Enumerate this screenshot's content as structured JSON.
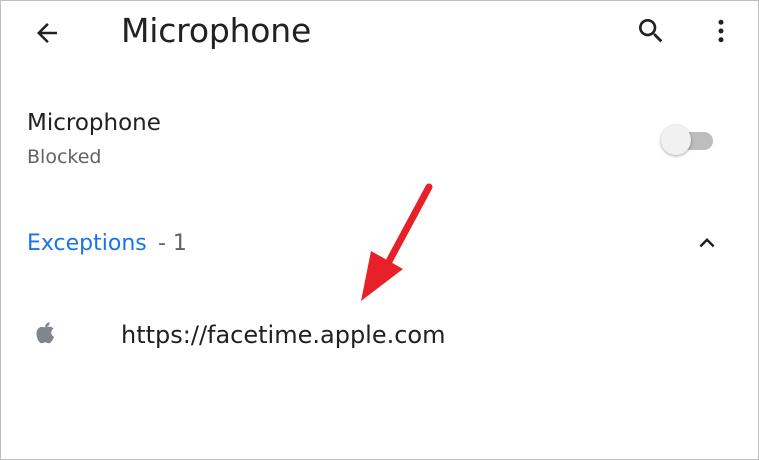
{
  "app_bar": {
    "back_icon": "arrow-left-icon",
    "title": "Microphone",
    "search_icon": "search-icon",
    "more_icon": "more-vertical-icon"
  },
  "setting": {
    "title": "Microphone",
    "status": "Blocked",
    "toggle_on": false
  },
  "exceptions": {
    "label": "Exceptions",
    "count_text": " - 1",
    "expanded": true,
    "collapse_icon": "chevron-up-icon",
    "sites": [
      {
        "icon": "apple-logo-icon",
        "url": "https://facetime.apple.com"
      }
    ]
  },
  "annotation": {
    "type": "arrow",
    "color": "#e8202a"
  },
  "colors": {
    "accent": "#1a73e8",
    "text_primary": "#202124",
    "text_secondary": "#5f6368",
    "toggle_track_off": "#bdbdbd"
  }
}
